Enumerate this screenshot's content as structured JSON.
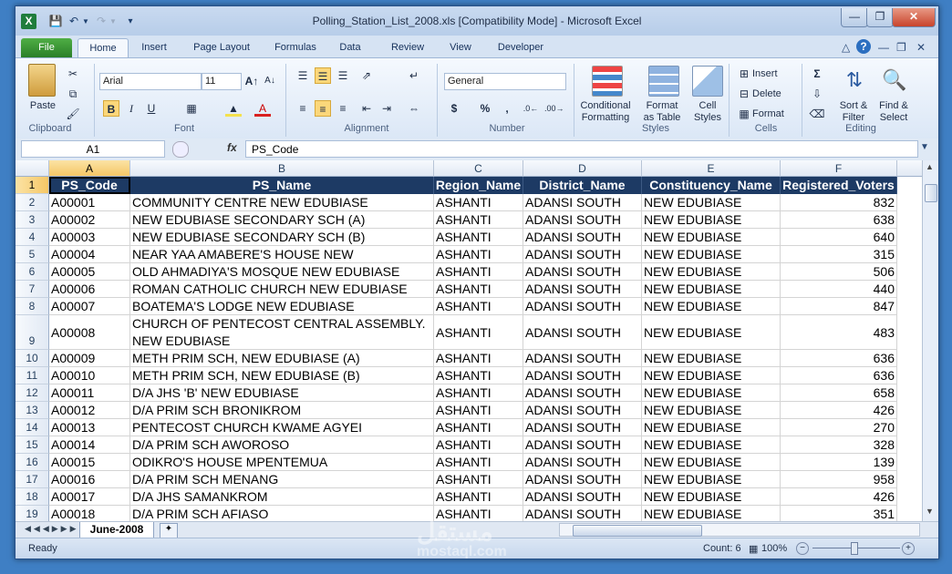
{
  "window": {
    "title": "Polling_Station_List_2008.xls  [Compatibility Mode]  -  Microsoft Excel",
    "app_icon": "X"
  },
  "tabs": [
    "File",
    "Home",
    "Insert",
    "Page Layout",
    "Formulas",
    "Data",
    "Review",
    "View",
    "Developer"
  ],
  "ribbon": {
    "clipboard": {
      "paste": "Paste",
      "label": "Clipboard"
    },
    "font": {
      "name": "Arial",
      "size": "11",
      "label": "Font"
    },
    "alignment": {
      "label": "Alignment"
    },
    "number": {
      "format": "General",
      "currency": "$",
      "percent": "%",
      "comma": ",",
      "label": "Number"
    },
    "styles": {
      "conditional": "Conditional\nFormatting",
      "format_table": "Format\nas Table",
      "cell_styles": "Cell\nStyles",
      "label": "Styles"
    },
    "cells": {
      "insert": "Insert",
      "delete": "Delete",
      "format": "Format",
      "label": "Cells"
    },
    "editing": {
      "sort": "Sort &\nFilter",
      "find": "Find &\nSelect",
      "label": "Editing"
    }
  },
  "formula_bar": {
    "name_box": "A1",
    "fx": "fx",
    "value": "PS_Code"
  },
  "columns": [
    "A",
    "B",
    "C",
    "D",
    "E",
    "F"
  ],
  "headers": [
    "PS_Code",
    "PS_Name",
    "Region_Name",
    "District_Name",
    "Constituency_Name",
    "Registered_Voters"
  ],
  "rows": [
    {
      "n": "2",
      "code": "A00001",
      "name": "COMMUNITY CENTRE NEW EDUBIASE",
      "region": "ASHANTI",
      "district": "ADANSI SOUTH",
      "const": "NEW EDUBIASE",
      "voters": "832"
    },
    {
      "n": "3",
      "code": "A00002",
      "name": "NEW EDUBIASE SECONDARY SCH (A)",
      "region": "ASHANTI",
      "district": "ADANSI SOUTH",
      "const": "NEW EDUBIASE",
      "voters": "638"
    },
    {
      "n": "4",
      "code": "A00003",
      "name": "NEW EDUBIASE SECONDARY SCH (B)",
      "region": "ASHANTI",
      "district": "ADANSI SOUTH",
      "const": "NEW EDUBIASE",
      "voters": "640"
    },
    {
      "n": "5",
      "code": "A00004",
      "name": "NEAR YAA AMABERE'S HOUSE NEW",
      "region": "ASHANTI",
      "district": "ADANSI SOUTH",
      "const": "NEW EDUBIASE",
      "voters": "315"
    },
    {
      "n": "6",
      "code": "A00005",
      "name": "OLD AHMADIYA'S MOSQUE NEW EDUBIASE",
      "region": "ASHANTI",
      "district": "ADANSI SOUTH",
      "const": "NEW EDUBIASE",
      "voters": "506"
    },
    {
      "n": "7",
      "code": "A00006",
      "name": "ROMAN CATHOLIC CHURCH  NEW EDUBIASE",
      "region": "ASHANTI",
      "district": "ADANSI SOUTH",
      "const": "NEW EDUBIASE",
      "voters": "440"
    },
    {
      "n": "8",
      "code": "A00007",
      "name": "BOATEMA'S LODGE NEW EDUBIASE",
      "region": "ASHANTI",
      "district": "ADANSI SOUTH",
      "const": "NEW EDUBIASE",
      "voters": "847"
    },
    {
      "n": "9",
      "code": "A00008",
      "name": "CHURCH OF PENTECOST CENTRAL ASSEMBLY. NEW EDUBIASE",
      "region": "ASHANTI",
      "district": "ADANSI SOUTH",
      "const": "NEW EDUBIASE",
      "voters": "483",
      "wrap": true
    },
    {
      "n": "10",
      "code": "A00009",
      "name": "METH PRIM SCH, NEW EDUBIASE (A)",
      "region": "ASHANTI",
      "district": "ADANSI SOUTH",
      "const": "NEW EDUBIASE",
      "voters": "636"
    },
    {
      "n": "11",
      "code": "A00010",
      "name": "METH PRIM SCH, NEW EDUBIASE (B)",
      "region": "ASHANTI",
      "district": "ADANSI SOUTH",
      "const": "NEW EDUBIASE",
      "voters": "636"
    },
    {
      "n": "12",
      "code": "A00011",
      "name": "D/A  JHS 'B' NEW EDUBIASE",
      "region": "ASHANTI",
      "district": "ADANSI SOUTH",
      "const": "NEW EDUBIASE",
      "voters": "658"
    },
    {
      "n": "13",
      "code": "A00012",
      "name": "D/A PRIM SCH BRONIKROM",
      "region": "ASHANTI",
      "district": "ADANSI SOUTH",
      "const": "NEW EDUBIASE",
      "voters": "426"
    },
    {
      "n": "14",
      "code": "A00013",
      "name": "PENTECOST CHURCH KWAME AGYEI",
      "region": "ASHANTI",
      "district": "ADANSI SOUTH",
      "const": "NEW EDUBIASE",
      "voters": "270"
    },
    {
      "n": "15",
      "code": "A00014",
      "name": "D/A PRIM SCH AWOROSO",
      "region": "ASHANTI",
      "district": "ADANSI SOUTH",
      "const": "NEW EDUBIASE",
      "voters": "328"
    },
    {
      "n": "16",
      "code": "A00015",
      "name": "ODIKRO'S HOUSE MPENTEMUA",
      "region": "ASHANTI",
      "district": "ADANSI SOUTH",
      "const": "NEW EDUBIASE",
      "voters": "139"
    },
    {
      "n": "17",
      "code": "A00016",
      "name": "D/A PRIM SCH MENANG",
      "region": "ASHANTI",
      "district": "ADANSI SOUTH",
      "const": "NEW EDUBIASE",
      "voters": "958"
    },
    {
      "n": "18",
      "code": "A00017",
      "name": "D/A JHS SAMANKROM",
      "region": "ASHANTI",
      "district": "ADANSI SOUTH",
      "const": "NEW EDUBIASE",
      "voters": "426"
    },
    {
      "n": "19",
      "code": "A00018",
      "name": "D/A PRIM SCH AFIASO",
      "region": "ASHANTI",
      "district": "ADANSI SOUTH",
      "const": "NEW EDUBIASE",
      "voters": "351"
    }
  ],
  "sheet_tab": "June-2008",
  "status": {
    "ready": "Ready",
    "count": "Count: 6",
    "zoom": "100%"
  },
  "watermark": {
    "arabic": "مستقل",
    "latin": "mostaql.com"
  }
}
